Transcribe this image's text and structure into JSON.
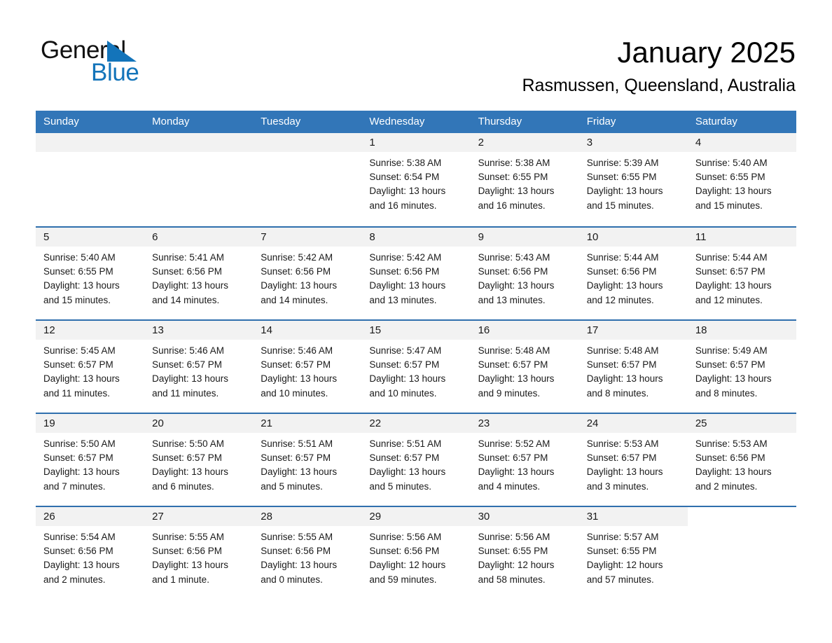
{
  "brand": {
    "name_part1": "General",
    "name_part2": "Blue",
    "accent_color": "#1374ba"
  },
  "header": {
    "month_title": "January 2025",
    "location": "Rasmussen, Queensland, Australia"
  },
  "calendar": {
    "header_color": "#3276b8",
    "row_border_color": "#2f6fad",
    "day_band_color": "#f2f2f2",
    "weekdays": [
      "Sunday",
      "Monday",
      "Tuesday",
      "Wednesday",
      "Thursday",
      "Friday",
      "Saturday"
    ],
    "weeks": [
      [
        {
          "day": "",
          "lines": []
        },
        {
          "day": "",
          "lines": []
        },
        {
          "day": "",
          "lines": []
        },
        {
          "day": "1",
          "lines": [
            "Sunrise: 5:38 AM",
            "Sunset: 6:54 PM",
            "Daylight: 13 hours",
            "and 16 minutes."
          ]
        },
        {
          "day": "2",
          "lines": [
            "Sunrise: 5:38 AM",
            "Sunset: 6:55 PM",
            "Daylight: 13 hours",
            "and 16 minutes."
          ]
        },
        {
          "day": "3",
          "lines": [
            "Sunrise: 5:39 AM",
            "Sunset: 6:55 PM",
            "Daylight: 13 hours",
            "and 15 minutes."
          ]
        },
        {
          "day": "4",
          "lines": [
            "Sunrise: 5:40 AM",
            "Sunset: 6:55 PM",
            "Daylight: 13 hours",
            "and 15 minutes."
          ]
        }
      ],
      [
        {
          "day": "5",
          "lines": [
            "Sunrise: 5:40 AM",
            "Sunset: 6:55 PM",
            "Daylight: 13 hours",
            "and 15 minutes."
          ]
        },
        {
          "day": "6",
          "lines": [
            "Sunrise: 5:41 AM",
            "Sunset: 6:56 PM",
            "Daylight: 13 hours",
            "and 14 minutes."
          ]
        },
        {
          "day": "7",
          "lines": [
            "Sunrise: 5:42 AM",
            "Sunset: 6:56 PM",
            "Daylight: 13 hours",
            "and 14 minutes."
          ]
        },
        {
          "day": "8",
          "lines": [
            "Sunrise: 5:42 AM",
            "Sunset: 6:56 PM",
            "Daylight: 13 hours",
            "and 13 minutes."
          ]
        },
        {
          "day": "9",
          "lines": [
            "Sunrise: 5:43 AM",
            "Sunset: 6:56 PM",
            "Daylight: 13 hours",
            "and 13 minutes."
          ]
        },
        {
          "day": "10",
          "lines": [
            "Sunrise: 5:44 AM",
            "Sunset: 6:56 PM",
            "Daylight: 13 hours",
            "and 12 minutes."
          ]
        },
        {
          "day": "11",
          "lines": [
            "Sunrise: 5:44 AM",
            "Sunset: 6:57 PM",
            "Daylight: 13 hours",
            "and 12 minutes."
          ]
        }
      ],
      [
        {
          "day": "12",
          "lines": [
            "Sunrise: 5:45 AM",
            "Sunset: 6:57 PM",
            "Daylight: 13 hours",
            "and 11 minutes."
          ]
        },
        {
          "day": "13",
          "lines": [
            "Sunrise: 5:46 AM",
            "Sunset: 6:57 PM",
            "Daylight: 13 hours",
            "and 11 minutes."
          ]
        },
        {
          "day": "14",
          "lines": [
            "Sunrise: 5:46 AM",
            "Sunset: 6:57 PM",
            "Daylight: 13 hours",
            "and 10 minutes."
          ]
        },
        {
          "day": "15",
          "lines": [
            "Sunrise: 5:47 AM",
            "Sunset: 6:57 PM",
            "Daylight: 13 hours",
            "and 10 minutes."
          ]
        },
        {
          "day": "16",
          "lines": [
            "Sunrise: 5:48 AM",
            "Sunset: 6:57 PM",
            "Daylight: 13 hours",
            "and 9 minutes."
          ]
        },
        {
          "day": "17",
          "lines": [
            "Sunrise: 5:48 AM",
            "Sunset: 6:57 PM",
            "Daylight: 13 hours",
            "and 8 minutes."
          ]
        },
        {
          "day": "18",
          "lines": [
            "Sunrise: 5:49 AM",
            "Sunset: 6:57 PM",
            "Daylight: 13 hours",
            "and 8 minutes."
          ]
        }
      ],
      [
        {
          "day": "19",
          "lines": [
            "Sunrise: 5:50 AM",
            "Sunset: 6:57 PM",
            "Daylight: 13 hours",
            "and 7 minutes."
          ]
        },
        {
          "day": "20",
          "lines": [
            "Sunrise: 5:50 AM",
            "Sunset: 6:57 PM",
            "Daylight: 13 hours",
            "and 6 minutes."
          ]
        },
        {
          "day": "21",
          "lines": [
            "Sunrise: 5:51 AM",
            "Sunset: 6:57 PM",
            "Daylight: 13 hours",
            "and 5 minutes."
          ]
        },
        {
          "day": "22",
          "lines": [
            "Sunrise: 5:51 AM",
            "Sunset: 6:57 PM",
            "Daylight: 13 hours",
            "and 5 minutes."
          ]
        },
        {
          "day": "23",
          "lines": [
            "Sunrise: 5:52 AM",
            "Sunset: 6:57 PM",
            "Daylight: 13 hours",
            "and 4 minutes."
          ]
        },
        {
          "day": "24",
          "lines": [
            "Sunrise: 5:53 AM",
            "Sunset: 6:57 PM",
            "Daylight: 13 hours",
            "and 3 minutes."
          ]
        },
        {
          "day": "25",
          "lines": [
            "Sunrise: 5:53 AM",
            "Sunset: 6:56 PM",
            "Daylight: 13 hours",
            "and 2 minutes."
          ]
        }
      ],
      [
        {
          "day": "26",
          "lines": [
            "Sunrise: 5:54 AM",
            "Sunset: 6:56 PM",
            "Daylight: 13 hours",
            "and 2 minutes."
          ]
        },
        {
          "day": "27",
          "lines": [
            "Sunrise: 5:55 AM",
            "Sunset: 6:56 PM",
            "Daylight: 13 hours",
            "and 1 minute."
          ]
        },
        {
          "day": "28",
          "lines": [
            "Sunrise: 5:55 AM",
            "Sunset: 6:56 PM",
            "Daylight: 13 hours",
            "and 0 minutes."
          ]
        },
        {
          "day": "29",
          "lines": [
            "Sunrise: 5:56 AM",
            "Sunset: 6:56 PM",
            "Daylight: 12 hours",
            "and 59 minutes."
          ]
        },
        {
          "day": "30",
          "lines": [
            "Sunrise: 5:56 AM",
            "Sunset: 6:55 PM",
            "Daylight: 12 hours",
            "and 58 minutes."
          ]
        },
        {
          "day": "31",
          "lines": [
            "Sunrise: 5:57 AM",
            "Sunset: 6:55 PM",
            "Daylight: 12 hours",
            "and 57 minutes."
          ]
        },
        {
          "day": "",
          "lines": []
        }
      ]
    ]
  }
}
